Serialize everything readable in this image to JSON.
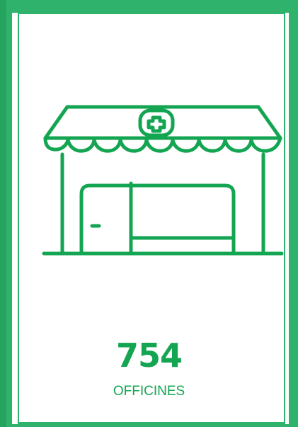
{
  "stat": {
    "value": "754",
    "label": "OFFICINES"
  },
  "icon": {
    "name": "pharmacy-shop-icon",
    "color": "#14a552"
  },
  "colors": {
    "frame": "#2fb36c",
    "accent": "#14a552",
    "background": "#ffffff"
  }
}
